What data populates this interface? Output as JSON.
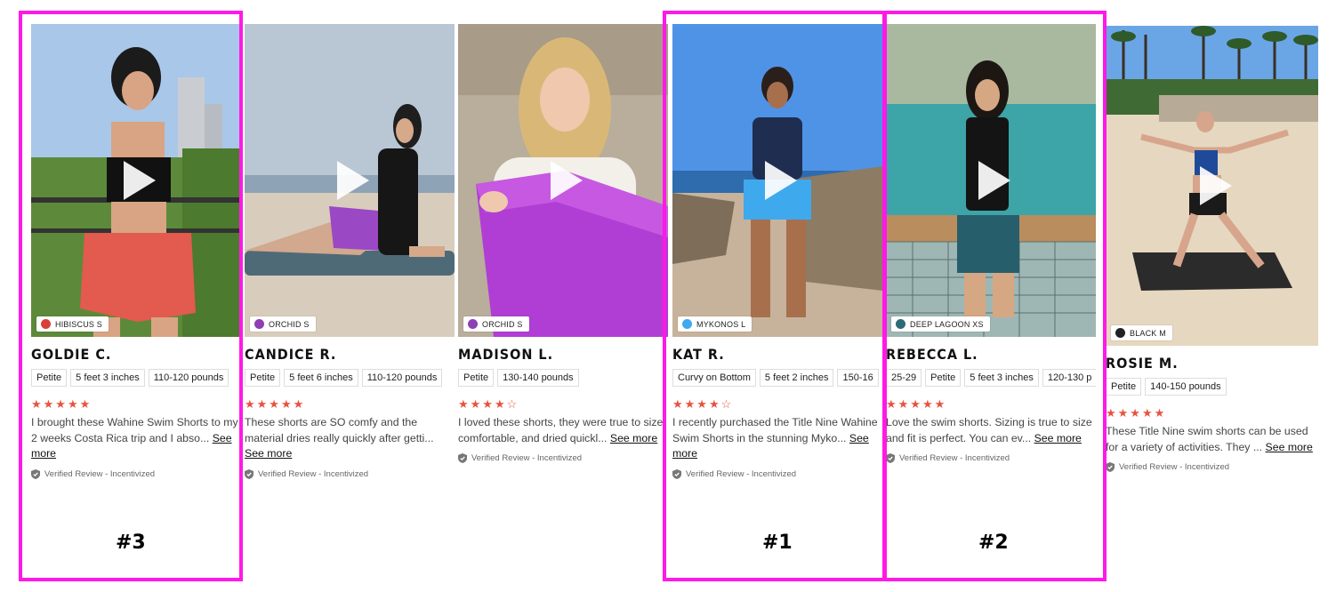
{
  "cards": [
    {
      "color_name": "HIBISCUS S",
      "color_hex": "#d9403a",
      "name": "GOLDIE C.",
      "tags": [
        "Petite",
        "5 feet 3 inches",
        "110-120 pounds"
      ],
      "rating": 5,
      "stars_text": "★★★★★",
      "review": "I brought these Wahine Swim Shorts to my 2 weeks Costa Rica trip and I abso...",
      "see_more": "See more",
      "verified": "Verified Review - Incentivized"
    },
    {
      "color_name": "ORCHID S",
      "color_hex": "#8e3fb3",
      "name": "CANDICE R.",
      "tags": [
        "Petite",
        "5 feet 6 inches",
        "110-120 pounds"
      ],
      "rating": 5,
      "stars_text": "★★★★★",
      "review": "These shorts are SO comfy and the material dries really quickly after getti...",
      "see_more": "See more",
      "verified": "Verified Review - Incentivized"
    },
    {
      "color_name": "ORCHID S",
      "color_hex": "#8e3fb3",
      "name": "MADISON L.",
      "tags": [
        "Petite",
        "130-140 pounds"
      ],
      "rating": 4,
      "stars_text": "★★★★☆",
      "review": "I loved these shorts, they were true to size, comfortable, and dried quickl...",
      "see_more": "See more",
      "verified": "Verified Review - Incentivized"
    },
    {
      "color_name": "MYKONOS L",
      "color_hex": "#3fa9ee",
      "name": "KAT R.",
      "tags": [
        "Curvy on Bottom",
        "5 feet 2 inches",
        "150-16"
      ],
      "rating": 4,
      "stars_text": "★★★★☆",
      "review": "I recently purchased the Title Nine Wahine Swim Shorts in the stunning Myko...",
      "see_more": "See more",
      "verified": "Verified Review - Incentivized"
    },
    {
      "color_name": "DEEP LAGOON XS",
      "color_hex": "#2d6b78",
      "name": "REBECCA L.",
      "tags": [
        "25-29",
        "Petite",
        "5 feet 3 inches",
        "120-130 p"
      ],
      "rating": 5,
      "stars_text": "★★★★★",
      "review": "Love the swim shorts. Sizing is true to size and fit is perfect. You can ev...",
      "see_more": "See more",
      "verified": "Verified Review - Incentivized"
    },
    {
      "color_name": "BLACK M",
      "color_hex": "#222222",
      "name": "ROSIE M.",
      "tags": [
        "Petite",
        "140-150 pounds"
      ],
      "rating": 5,
      "stars_text": "★★★★★",
      "review": "These Title Nine swim shorts can be used for a variety of activities. They ...",
      "see_more": "See more",
      "verified": "Verified Review - Incentivized"
    }
  ],
  "rank_labels": {
    "first": "#1",
    "second": "#2",
    "third": "#3"
  },
  "highlight_color": "#ff19e6"
}
